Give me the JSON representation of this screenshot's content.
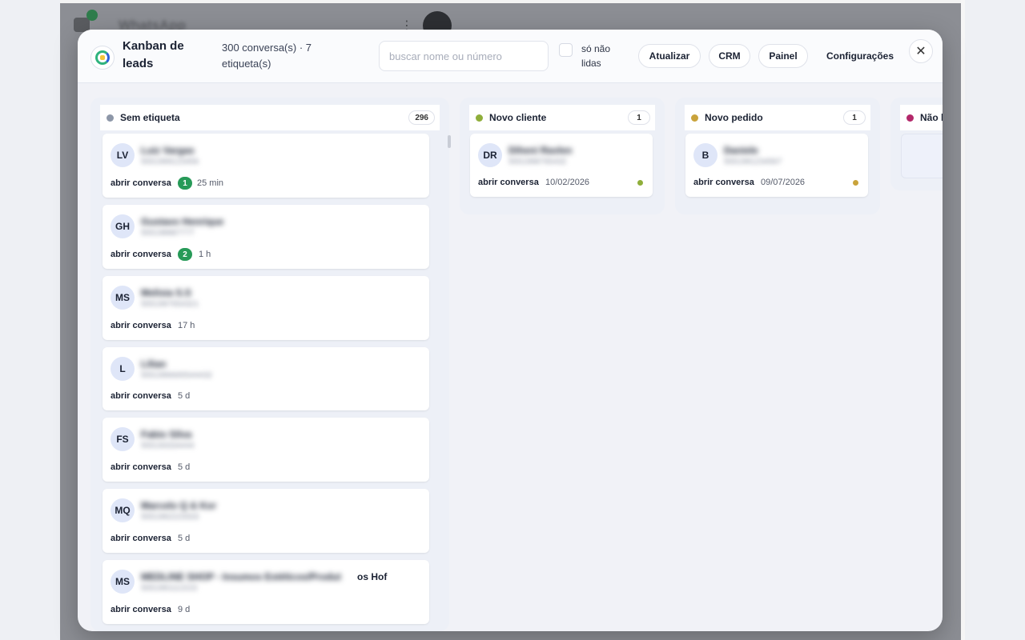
{
  "background": {
    "app_title": "WhatsApp"
  },
  "header": {
    "title": "Kanban de leads",
    "summary": "300 conversa(s) · 7 etiqueta(s)",
    "search_placeholder": "buscar nome ou número",
    "unread_label": "só não lidas",
    "buttons": {
      "refresh": "Atualizar",
      "crm": "CRM",
      "panel": "Painel",
      "settings": "Configurações"
    },
    "close_symbol": "✕"
  },
  "columns": [
    {
      "title": "Sem etiqueta",
      "count": "296",
      "dot_color": "#8d97a8",
      "cards": [
        {
          "initials": "LV",
          "name": "Luiz Vargas",
          "phone": "5551999123456",
          "action": "abrir conversa",
          "badge": "1",
          "time": "25 min"
        },
        {
          "initials": "GH",
          "name": "Gustavo Henrique",
          "phone": "555198887777",
          "action": "abrir conversa",
          "badge": "2",
          "time": "1 h"
        },
        {
          "initials": "MS",
          "name": "Melisia S.S",
          "phone": "5551997654321",
          "action": "abrir conversa",
          "badge": "",
          "time": "17 h"
        },
        {
          "initials": "L",
          "name": "Lilian",
          "phone": "5551996665544432",
          "action": "abrir conversa",
          "badge": "",
          "time": "5 d"
        },
        {
          "initials": "FS",
          "name": "Fabio Silva",
          "phone": "555193334444",
          "action": "abrir conversa",
          "badge": "",
          "time": "5 d"
        },
        {
          "initials": "MQ",
          "name": "Marcelo Q & Kor",
          "phone": "5551992223333",
          "action": "abrir conversa",
          "badge": "",
          "time": "5 d"
        },
        {
          "initials": "MS",
          "name": "MEDLINE SHOP - Insumos Estéticos/Produt",
          "name_suffix": "os Hof",
          "phone": "5551991112222",
          "action": "abrir conversa",
          "badge": "",
          "time": "9 d"
        }
      ]
    },
    {
      "title": "Novo cliente",
      "count": "1",
      "dot_color": "#8fae3a",
      "cards": [
        {
          "initials": "DR",
          "name": "Diheni Ravlen",
          "phone": "5551998765432",
          "action": "abrir conversa",
          "time": "10/02/2026",
          "status_color": "#8fae3a"
        }
      ]
    },
    {
      "title": "Novo pedido",
      "count": "1",
      "dot_color": "#c9a33b",
      "cards": [
        {
          "initials": "B",
          "name": "Daniele",
          "phone": "5551991234567",
          "action": "abrir conversa",
          "time": "09/07/2026",
          "status_color": "#c9a33b"
        }
      ]
    },
    {
      "title": "Não l",
      "count": "",
      "dot_color": "#b3286a",
      "cards": []
    }
  ]
}
